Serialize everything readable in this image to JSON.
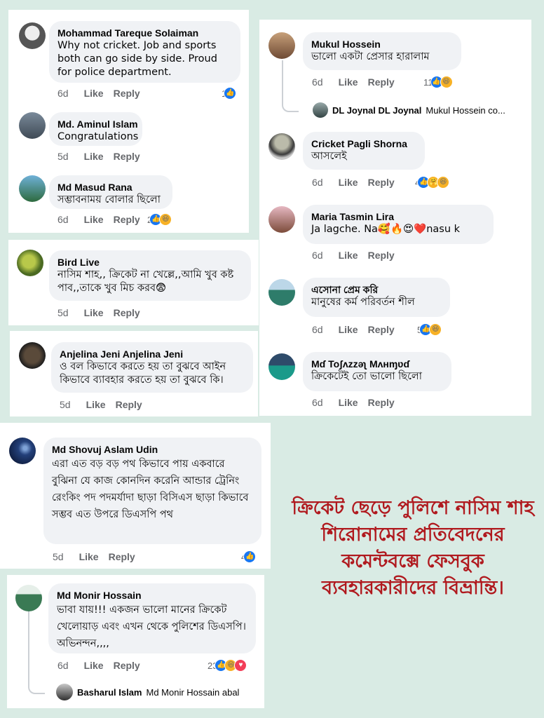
{
  "comments": [
    {
      "name": "Mohammad Tareque Solaiman",
      "text": "Why not cricket.  Job and sports both can go side by side. Proud for police department.",
      "time": "6d",
      "like": "Like",
      "reply": "Reply",
      "count": "1"
    },
    {
      "name": "Md. Aminul Islam",
      "text": "Congratulations",
      "time": "5d",
      "like": "Like",
      "reply": "Reply"
    },
    {
      "name": "Md Masud Rana",
      "text": "সম্ভাবনাময় বোলার ছিলো",
      "time": "6d",
      "like": "Like",
      "reply": "Reply",
      "count": "2"
    },
    {
      "name": "Bird Live",
      "text": "নাসিম শাহ,, ক্রিকেট না খেল্লে,,আমি খুব কষ্ট পাব,,তাকে খুব মিচ করব😨",
      "time": "5d",
      "like": "Like",
      "reply": "Reply"
    },
    {
      "name": "Anjelina Jeni Anjelina Jeni",
      "text": "ও বল কিভাবে করতে হয় তা বুঝবে আইন কিভাবে ব্যাবহার করতে হয় তা বুঝবে কি।",
      "time": "5d",
      "like": "Like",
      "reply": "Reply"
    },
    {
      "name": "Mukul Hossein",
      "text": "ভালো একটা প্রেসার হারালাম",
      "time": "6d",
      "like": "Like",
      "reply": "Reply",
      "count": "11"
    },
    {
      "name": "Cricket Pagli Shorna",
      "text": "আসলেই",
      "time": "6d",
      "like": "Like",
      "reply": "Reply",
      "count": "4"
    },
    {
      "name": "Maria Tasmin Lira",
      "text": "Ja lagche. Na🥰🔥😍❤️nasu k",
      "time": "6d",
      "like": "Like",
      "reply": "Reply"
    },
    {
      "name": "এসোনা প্রেম করি",
      "text": "মানুষের কর্ম পরিবর্তন শীল",
      "time": "6d",
      "like": "Like",
      "reply": "Reply",
      "count": "5"
    },
    {
      "name": "Mɗ Toʃʌzzəʅ Mʌнɱʋɗ",
      "text": "ক্রিকেটেই তো ভালো ছিলো",
      "time": "6d",
      "like": "Like",
      "reply": "Reply"
    },
    {
      "name": "Md Shovuj Aslam Udin",
      "text": "এরা এত বড় বড় পথ কিভাবে পায় একবারে বুঝিনা যে কাজ কোনদিন করেনি আন্ডার ট্রেনিং রেংকিং পদ পদমর্যাদা ছাড়া বিসিএস ছাড়া কিভাবে সম্ভব এত উপরে ডিএসপি পথ",
      "time": "5d",
      "like": "Like",
      "reply": "Reply",
      "count": "4"
    },
    {
      "name": "Md Monir Hossain",
      "text": "ভাবা যায়!!! একজন ভালো মানের ক্রিকেট খেলোয়াড় এবং এখন থেকে পুলিশের ডিএসপি। অভিনন্দন,,,,",
      "time": "6d",
      "like": "Like",
      "reply": "Reply",
      "count": "23"
    }
  ],
  "replies": [
    {
      "name": "DL Joynal DL Joynal",
      "text": "Mukul Hossein co..."
    },
    {
      "name": "Basharul Islam",
      "text": "Md Monir Hossain abal"
    }
  ],
  "caption": "ক্রিকেট ছেড়ে পুলিশে নাসিম শাহ শিরোনামের প্রতিবেদনের কমেন্টবক্সে ফেসবুক ব্যবহারকারীদের বিভ্রান্তি।",
  "colors": {
    "background": "#d9ebe4",
    "caption": "#b0191e",
    "like_blue": "#1877f2",
    "bubble": "#f0f2f5"
  }
}
